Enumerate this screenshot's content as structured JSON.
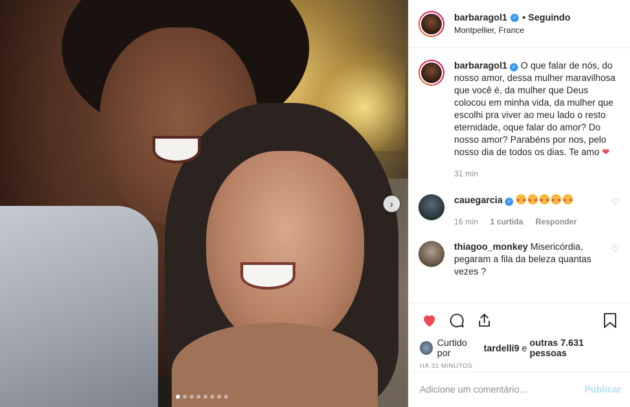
{
  "post": {
    "username": "barbaragol1",
    "follow_status": "• Seguindo",
    "location": "Montpellier, France",
    "verified": true
  },
  "photo": {
    "carousel_count": 8,
    "active_index": 0,
    "next_icon": "chevron-right-icon"
  },
  "caption": {
    "username": "barbaragol1",
    "text": "O que falar de nós, do nosso amor, dessa mulher maravilhosa que você é, da mulher que Deus colocou em minha vida, da mulher que escolhi pra viver ao meu lado o resto eternidade, oque falar do amor? Do nosso amor? Parabéns por nos, pelo nosso dia de todos os dias. Te amo",
    "emoji": "❤",
    "time": "31 min"
  },
  "comments": [
    {
      "username": "cauegarcia",
      "verified": true,
      "text": "",
      "emoji_count": 5,
      "time": "16 min",
      "likes": "1 curtida",
      "reply": "Responder"
    },
    {
      "username": "thiagoo_monkey",
      "verified": false,
      "text": "Misericórdia, pegaram a fila da beleza quantas vezes ?"
    }
  ],
  "actions": {
    "like_icon": "heart-filled-icon",
    "comment_icon": "comment-icon",
    "share_icon": "share-icon",
    "save_icon": "bookmark-icon",
    "liked_by_prefix": "Curtido por",
    "liked_by_user": "tardelli9",
    "liked_by_middle": "e",
    "liked_by_others": "outras 7.631 pessoas",
    "timestamp": "HÁ 31 MINUTOS"
  },
  "add_comment": {
    "placeholder": "Adicione um comentário...",
    "publish": "Publicar"
  },
  "colors": {
    "like_red": "#ed4956",
    "verified_blue": "#3897f0",
    "publish_disabled": "#b2dffc"
  }
}
